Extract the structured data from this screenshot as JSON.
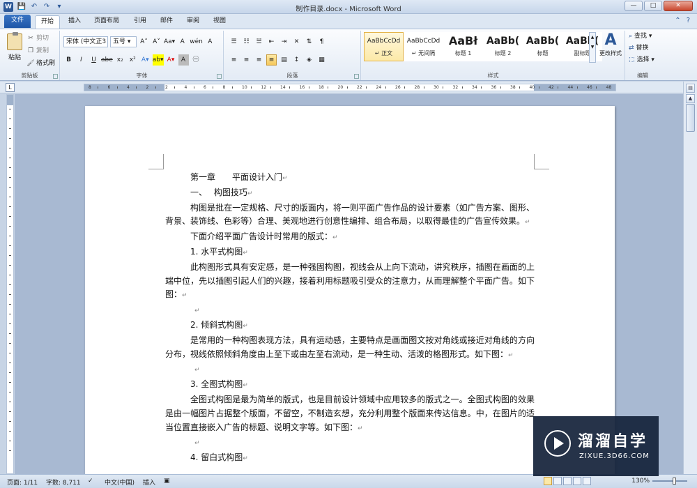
{
  "window": {
    "title": "制作目录.docx - Microsoft Word",
    "app_logo": "W",
    "minimize": "—",
    "maximize": "□",
    "close": "✕"
  },
  "qat": [
    "💾",
    "↶",
    "↷",
    "▾"
  ],
  "tabs": {
    "file": "文件",
    "home": "开始",
    "insert": "插入",
    "layout": "页面布局",
    "references": "引用",
    "mailings": "邮件",
    "review": "审阅",
    "view": "视图"
  },
  "ribbon": {
    "clipboard": {
      "label": "剪贴板",
      "paste": "粘贴",
      "cut": "剪切",
      "copy": "复制",
      "format_painter": "格式刷"
    },
    "font": {
      "label": "字体",
      "name": "宋体 (中文正3 ▾",
      "size": "五号 ▾",
      "grow": "A˄",
      "shrink": "A˅",
      "aa": "Aa▾",
      "clear": "A",
      "pinyin": "wén",
      "border": "A",
      "bold": "B",
      "italic": "I",
      "underline": "U",
      "strike": "abe",
      "sub": "x₂",
      "sup": "x²",
      "effects": "A▾",
      "highlight": "ab▾",
      "color": "A▾",
      "shade": "A",
      "circle": "㊀"
    },
    "paragraph": {
      "label": "段落"
    },
    "styles": {
      "label": "样式",
      "items": [
        {
          "sample": "AaBbCcDd",
          "name": "↵ 正文"
        },
        {
          "sample": "AaBbCcDd",
          "name": "↵ 无间隔"
        },
        {
          "sample": "AaBł",
          "name": "标题 1"
        },
        {
          "sample": "AaBb(",
          "name": "标题 2"
        },
        {
          "sample": "AaBb(",
          "name": "标题"
        },
        {
          "sample": "AaBb(",
          "name": "副标题"
        }
      ],
      "change": "更改样式"
    },
    "editing": {
      "label": "编辑",
      "find": "查找 ▾",
      "replace": "替换",
      "select": "选择 ▾"
    }
  },
  "document": {
    "paragraphs": [
      {
        "text": "第一章　　平面设计入门",
        "mark": "↵"
      },
      {
        "text": "一、　 构图技巧",
        "mark": "↵"
      },
      {
        "text": "构图是批在一定规格、尺寸的版面内，将一则平面广告作品的设计要素（如广告方案、图形、背景、装饰线、色彩等）合理、美观地进行创意性编排、组合布局，以取得最佳的广告宣传效果。",
        "mark": "↵"
      },
      {
        "text": "下面介绍平面广告设计时常用的版式：",
        "mark": "↵"
      },
      {
        "text": "1. 水平式构图",
        "mark": "↵"
      },
      {
        "text": "此构图形式具有安定感，是一种强固构图，视线会从上向下流动，讲究秩序，插图在画面的上端中位，先以插图引起人们的兴趣，接着利用标题吸引受众的注意力，从而理解整个平面广告。如下图：",
        "mark": "↵"
      },
      {
        "text": "",
        "mark": "↵"
      },
      {
        "text": "2. 倾斜式构图",
        "mark": "↵"
      },
      {
        "text": "是常用的一种构图表现方法，具有运动感，主要特点是画面图文按对角线或接近对角线的方向分布，视线依照倾斜角度由上至下或由左至右流动，是一种生动、活泼的格图形式。如下图：",
        "mark": "↵"
      },
      {
        "text": "",
        "mark": "↵"
      },
      {
        "text": "3. 全图式构图",
        "mark": "↵"
      },
      {
        "text": "全图式构图是最为简单的版式，也是目前设计领域中应用较多的版式之一。全图式构图的效果是由一幅图片占据整个版面，不留空，不制造玄想，充分利用整个版面来传达信息。中，在图片的适当位置直接嵌入广告的标题、说明文字等。如下图：",
        "mark": "↵"
      },
      {
        "text": "",
        "mark": "↵"
      },
      {
        "text": "4. 留白式构图",
        "mark": "↵"
      }
    ]
  },
  "ruler": {
    "numbers": [
      "8",
      "6",
      "4",
      "2",
      "2",
      "4",
      "6",
      "8",
      "10",
      "12",
      "14",
      "16",
      "18",
      "20",
      "22",
      "24",
      "26",
      "28",
      "30",
      "32",
      "34",
      "36",
      "38",
      "40",
      "42",
      "44",
      "46",
      "48"
    ]
  },
  "status": {
    "page": "页面: 1/11",
    "words": "字数: 8,711",
    "lang": "中文(中国)",
    "mode": "插入",
    "zoom": "130%"
  },
  "watermark": {
    "title": "溜溜自学",
    "sub": "ZIXUE.3D66.COM"
  }
}
